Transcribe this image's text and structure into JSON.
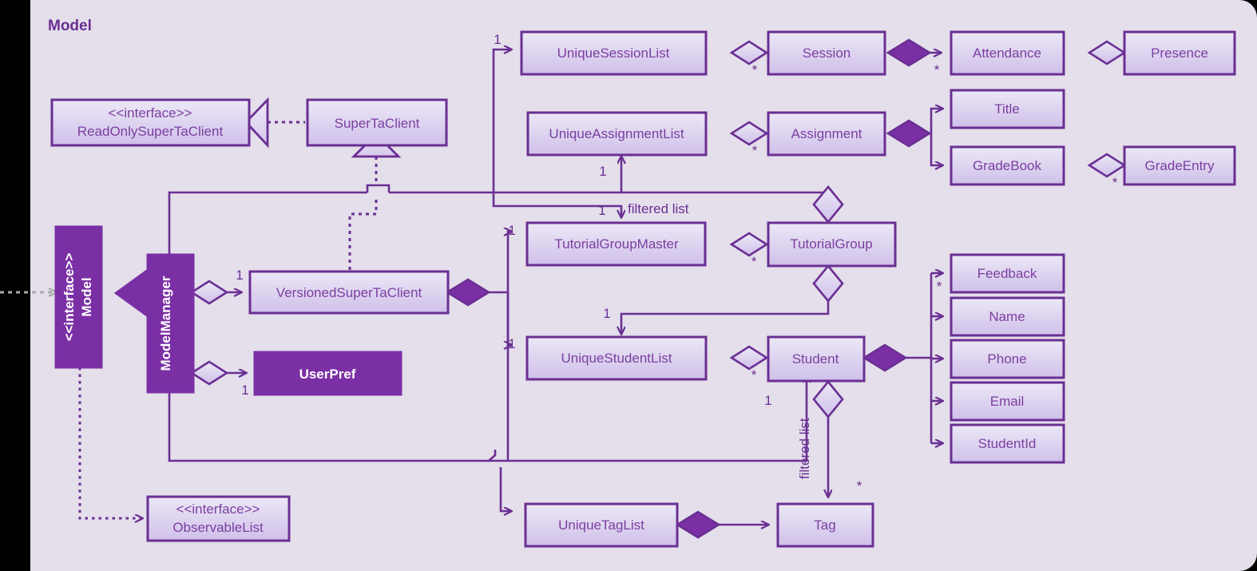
{
  "diagram": {
    "title": "Model",
    "type": "UML class diagram",
    "background_color": "#e4dfeb",
    "accent_color": "#7b3fa0",
    "border_color": "#6a2f93",
    "solid_fill_color": "#7b2fa5",
    "canvas_color": "#000000"
  },
  "classes": {
    "read_only_super_ta_client": {
      "stereotype": "<<interface>>",
      "name": "ReadOnlySuperTaClient"
    },
    "super_ta_client": {
      "name": "SuperTaClient"
    },
    "model": {
      "stereotype": "<<interface>>",
      "name": "Model"
    },
    "model_manager": {
      "name": "ModelManager"
    },
    "versioned_super_ta_client": {
      "name": "VersionedSuperTaClient"
    },
    "user_pref": {
      "name": "UserPref"
    },
    "observable_list": {
      "stereotype": "<<interface>>",
      "name": "ObservableList"
    },
    "unique_session_list": {
      "name": "UniqueSessionList"
    },
    "session": {
      "name": "Session"
    },
    "attendance": {
      "name": "Attendance"
    },
    "presence": {
      "name": "Presence"
    },
    "unique_assignment_list": {
      "name": "UniqueAssignmentList"
    },
    "assignment": {
      "name": "Assignment"
    },
    "title_attr": {
      "name": "Title"
    },
    "grade_book": {
      "name": "GradeBook"
    },
    "grade_entry": {
      "name": "GradeEntry"
    },
    "tutorial_group_master": {
      "name": "TutorialGroupMaster"
    },
    "tutorial_group": {
      "name": "TutorialGroup"
    },
    "unique_student_list": {
      "name": "UniqueStudentList"
    },
    "student": {
      "name": "Student"
    },
    "feedback": {
      "name": "Feedback"
    },
    "name_attr": {
      "name": "Name"
    },
    "phone": {
      "name": "Phone"
    },
    "email": {
      "name": "Email"
    },
    "student_id": {
      "name": "StudentId"
    },
    "unique_tag_list": {
      "name": "UniqueTagList"
    },
    "tag": {
      "name": "Tag"
    }
  },
  "multiplicities": {
    "session_list_in": "1",
    "session_list_to_session": "*",
    "session_to_attendance": "*",
    "assignment_list_to_assignment": "*",
    "grade_book_to_grade_entry": "*",
    "tutorial_group_to_assignment_list": "1",
    "tgm_filtered": "1",
    "tgm_in": "1",
    "tgm_to_tg": "*",
    "tg_to_student_list": "1",
    "student_list_in": "1",
    "student_list_to_student": "*",
    "student_to_feedback": "*",
    "student_to_tag": "*",
    "student_filtered": "1",
    "mm_to_versioned": "1",
    "mm_to_userpref": "1"
  },
  "edge_labels": {
    "filtered_list_top": "filtered list",
    "filtered_list_student": "filtered list"
  }
}
